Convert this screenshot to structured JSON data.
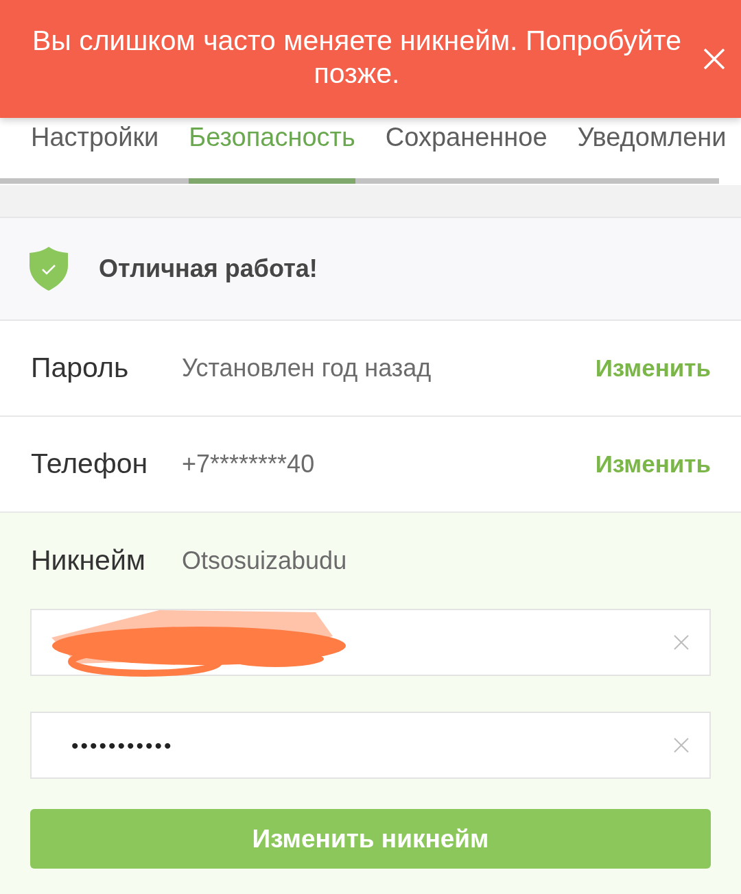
{
  "toast": {
    "message": "Вы слишком часто меняете никнейм. Попробуйте позже."
  },
  "tabs": [
    {
      "label": "Настройки",
      "selected": false
    },
    {
      "label": "Безопасность",
      "selected": true
    },
    {
      "label": "Сохраненное",
      "selected": false
    },
    {
      "label": "Уведомлени",
      "selected": false
    }
  ],
  "status_banner": {
    "text": "Отличная работа!"
  },
  "rows": [
    {
      "label": "Пароль",
      "value": "Установлен год назад",
      "action": "Изменить"
    },
    {
      "label": "Телефон",
      "value": "+7********40",
      "action": "Изменить"
    }
  ],
  "nickname": {
    "label": "Никнейм",
    "value": "Otsosuizabudu",
    "inputs": [
      {
        "redacted": true
      },
      {
        "value": "•••••••••••",
        "redacted": false
      }
    ],
    "button": "Изменить никнейм"
  }
}
